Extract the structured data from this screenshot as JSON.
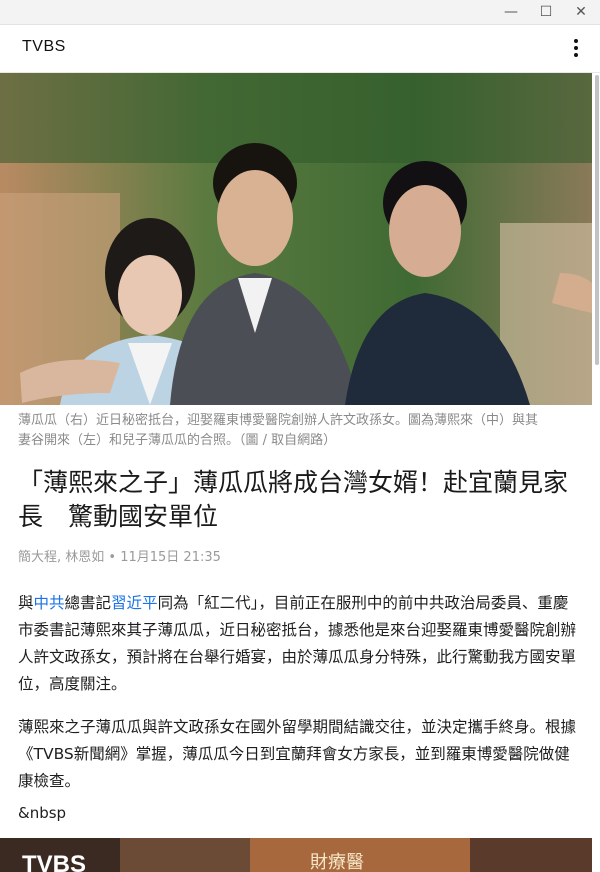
{
  "window": {
    "minimize_icon": "minimize-icon",
    "maximize_icon": "maximize-icon",
    "close_icon": "close-icon",
    "minimize_glyph": "—",
    "maximize_glyph": "☐",
    "close_glyph": "✕"
  },
  "app": {
    "title": "TVBS",
    "menu_icon": "more-vertical-icon"
  },
  "article": {
    "caption": "薄瓜瓜（右）近日秘密抵台，迎娶羅東博愛醫院創辦人許文政孫女。圖為薄熙來（中）與其妻谷開來（左）和兒子薄瓜瓜的合照。（圖 / 取自網路）",
    "headline": "「薄熙來之子」薄瓜瓜將成台灣女婿！赴宜蘭見家長　驚動國安單位",
    "authors": "簡大程, 林恩如",
    "date_sep": " • ",
    "date": "11月15日 21:35",
    "p1_a": "與",
    "p1_link1": "中共",
    "p1_b": "總書記",
    "p1_link2": "習近平",
    "p1_c": "同為「紅二代」，目前正在服刑中的前中共政治局委員、重慶市委書記薄熙來其子薄瓜瓜，近日秘密抵台，據悉他是來台迎娶羅東博愛醫院創辦人許文政孫女，預計將在台舉行婚宴，由於薄瓜瓜身分特殊，此行驚動我方國安單位，高度關注。",
    "p2": "薄熙來之子薄瓜瓜與許文政孫女在國外留學期間結識交往，並決定攜手終身。根據《TVBS新聞網》掌握，薄瓜瓜今日到宜蘭拜會女方家長，並到羅東博愛醫院做健康檢查。",
    "nbsp": "&nbsp",
    "photo2_text": "財療醫"
  },
  "colors": {
    "link": "#1a73e8",
    "caption": "#8a8a8a",
    "byline": "#9a9a9a"
  }
}
